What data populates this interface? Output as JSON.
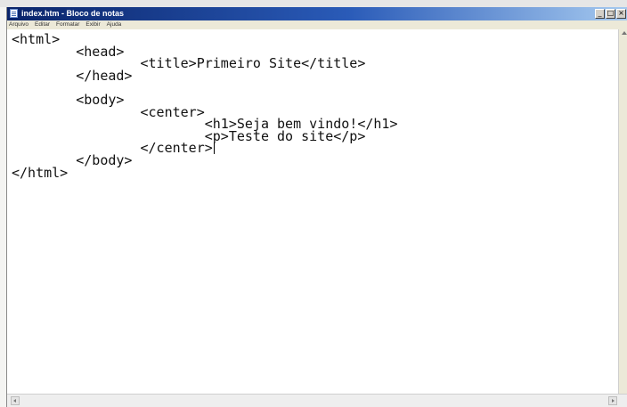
{
  "window": {
    "title": "index.htm - Bloco de notas",
    "minimize_label": "_",
    "maximize_label": "□",
    "close_label": "×"
  },
  "menu": {
    "items": [
      "Arquivo",
      "Editar",
      "Formatar",
      "Exibir",
      "Ajuda"
    ]
  },
  "editor": {
    "lines": [
      "<html>",
      "        <head>",
      "                <title>Primeiro Site</title>",
      "        </head>",
      "",
      "        <body>",
      "                <center>",
      "                        <h1>Seja bem vindo!</h1>",
      "                        <p>Teste do site</p>",
      "                </center>",
      "        </body>",
      "</html>"
    ],
    "cursor_line": 9
  },
  "colors": {
    "titlebar_start": "#0a246a",
    "titlebar_end": "#a6caf0",
    "editor_background": "#ffffff",
    "text": "#111111"
  }
}
